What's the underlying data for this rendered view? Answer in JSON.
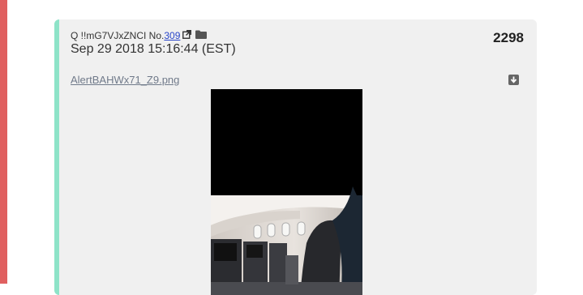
{
  "post": {
    "author": "Q !!mG7VJxZNCI No.",
    "post_number": "309",
    "timestamp": "Sep 29 2018 15:16:44 (EST)",
    "count": "2298",
    "filename": "AlertBAHWx71_Z9.png"
  },
  "icons": {
    "external_link": "external-link-icon",
    "folder": "folder-icon",
    "download": "download-icon"
  },
  "colors": {
    "left_accent": "#e06060",
    "post_accent": "#8ee3c8",
    "card_background": "#f0f0f0",
    "link": "#2a46c9"
  }
}
